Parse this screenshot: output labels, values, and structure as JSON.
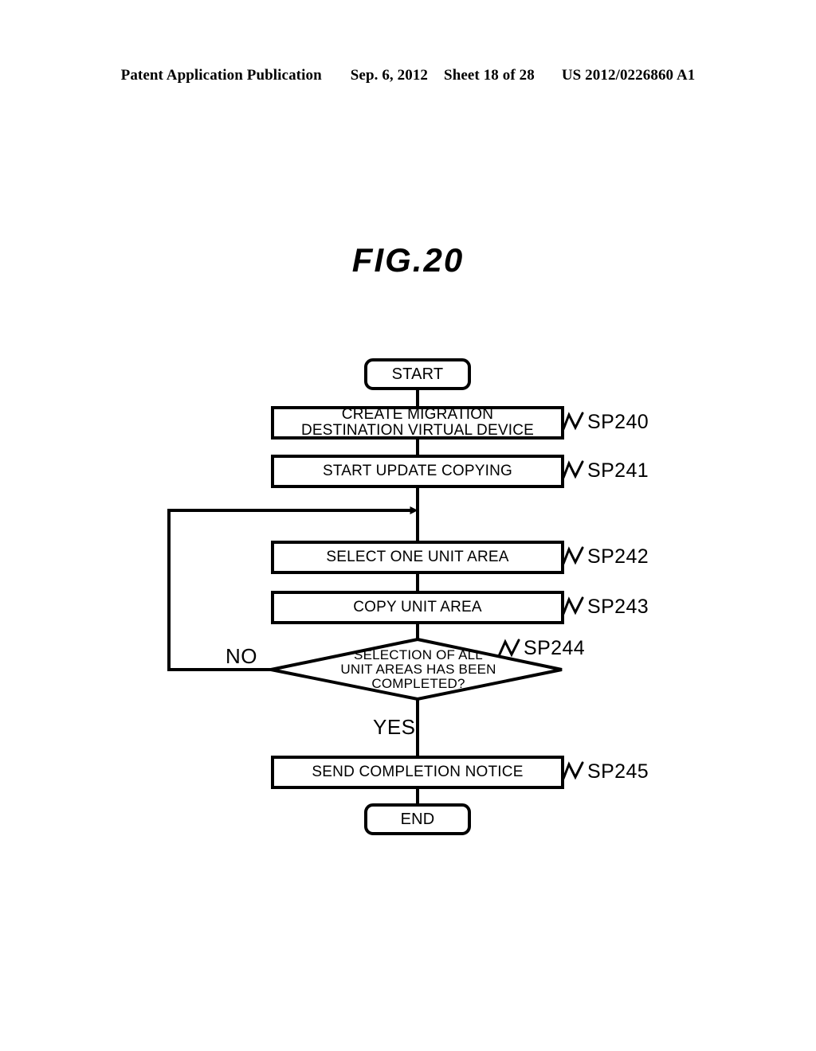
{
  "header": {
    "publication": "Patent Application Publication",
    "date": "Sep. 6, 2012",
    "sheet": "Sheet 18 of 28",
    "number": "US 2012/0226860 A1"
  },
  "figure": {
    "title": "FIG.20"
  },
  "flowchart": {
    "start": {
      "label": "START"
    },
    "end": {
      "label": "END"
    },
    "steps": [
      {
        "tag": "SP240",
        "label": "CREATE MIGRATION\nDESTINATION VIRTUAL DEVICE"
      },
      {
        "tag": "SP241",
        "label": "START UPDATE COPYING"
      },
      {
        "tag": "SP242",
        "label": "SELECT ONE UNIT AREA"
      },
      {
        "tag": "SP243",
        "label": "COPY UNIT AREA"
      },
      {
        "tag": "SP244",
        "label": "SELECTION OF ALL\nUNIT AREAS HAS BEEN\nCOMPLETED?"
      },
      {
        "tag": "SP245",
        "label": "SEND COMPLETION NOTICE"
      }
    ],
    "branches": {
      "no": "NO",
      "yes": "YES"
    },
    "colors": {
      "stroke": "#000000",
      "fill": "#ffffff"
    }
  }
}
